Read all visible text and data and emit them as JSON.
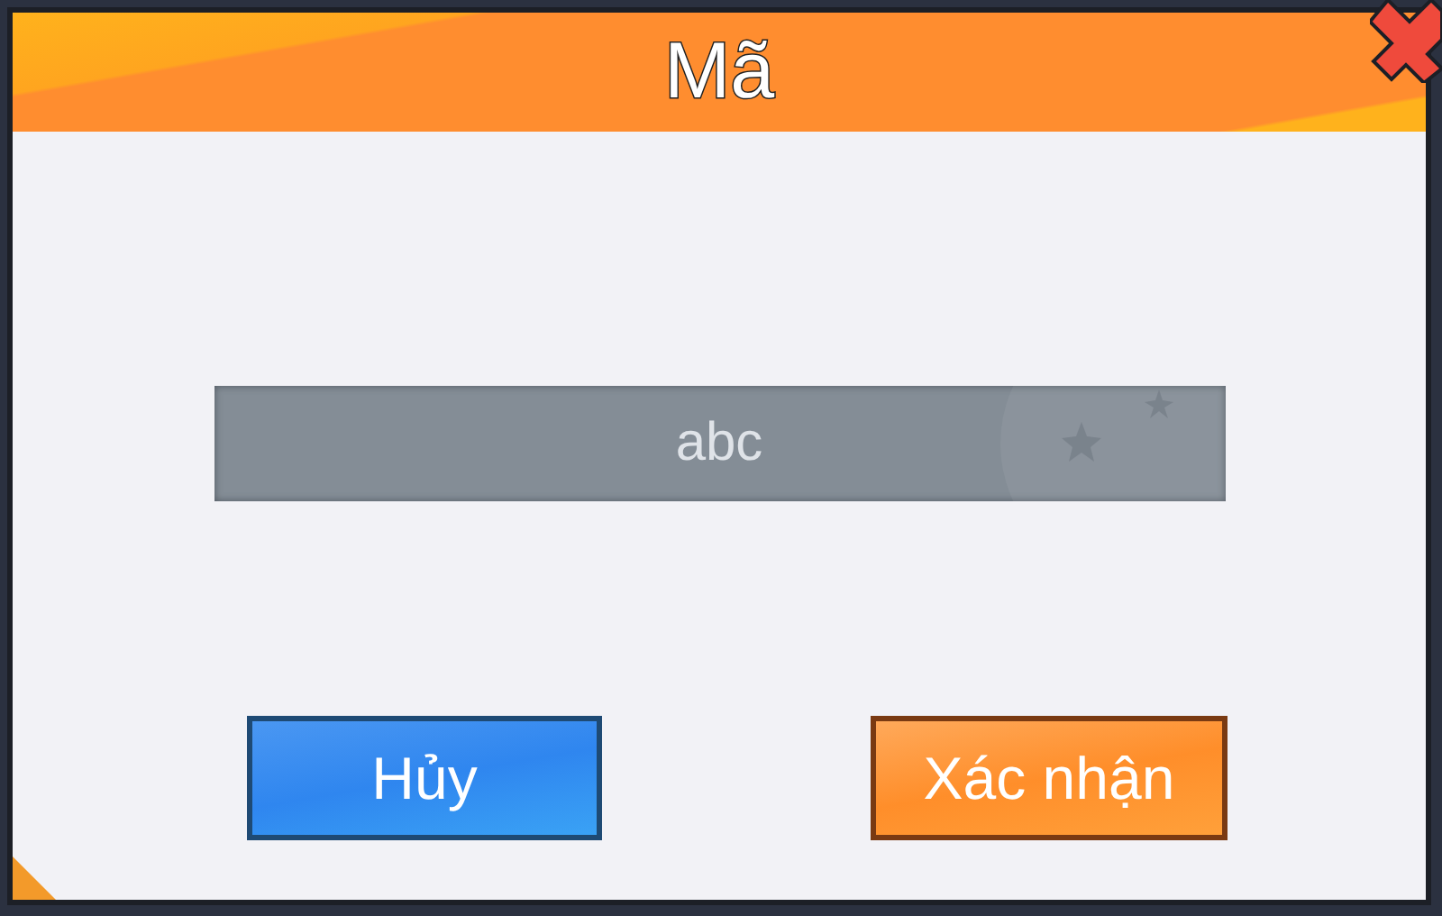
{
  "dialog": {
    "title": "Mã"
  },
  "code_field": {
    "value": "abc"
  },
  "buttons": [
    {
      "label": "Hủy",
      "kind": "cancel"
    },
    {
      "label": "Xác nhận",
      "kind": "confirm"
    }
  ]
}
